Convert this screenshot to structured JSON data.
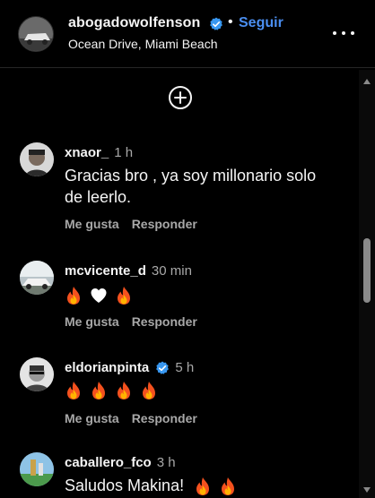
{
  "post": {
    "username": "abogadowolfenson",
    "separator": "•",
    "follow_label": "Seguir",
    "location": "Ocean Drive, Miami Beach",
    "add_comment_icon": "plus-circle-icon",
    "more_icon": "ellipsis-icon",
    "verified_color": "#3897f0"
  },
  "comments": [
    {
      "username": "xnaor_",
      "time": "1 h",
      "text": "Gracias bro , ya soy millonario solo de leerlo.",
      "like_label": "Me gusta",
      "reply_label": "Responder"
    },
    {
      "username": "mcvicente_d",
      "time": "30 min",
      "emojis": [
        "fire",
        "white-heart",
        "fire"
      ],
      "like_label": "Me gusta",
      "reply_label": "Responder"
    },
    {
      "username": "eldorianpinta",
      "verified": true,
      "time": "5 h",
      "emojis": [
        "fire",
        "fire",
        "fire",
        "fire"
      ],
      "like_label": "Me gusta",
      "reply_label": "Responder"
    },
    {
      "username": "caballero_fco",
      "time": "3 h",
      "text": "Saludos Makina!",
      "emojis": [
        "fire",
        "fire"
      ]
    }
  ],
  "colors": {
    "background": "#000000",
    "text": "#f5f5f5",
    "secondary_text": "#a8a8a8",
    "link": "#4a8ef0"
  }
}
